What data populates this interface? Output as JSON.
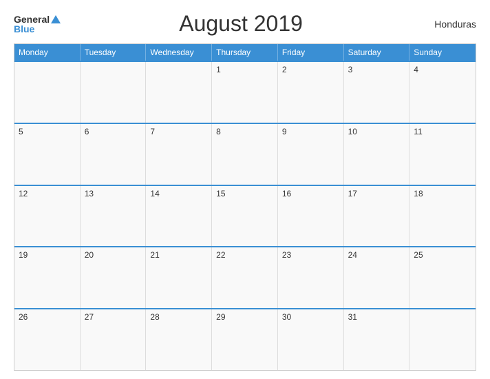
{
  "header": {
    "title": "August 2019",
    "country": "Honduras",
    "logo": {
      "general": "General",
      "blue": "Blue"
    }
  },
  "days": [
    "Monday",
    "Tuesday",
    "Wednesday",
    "Thursday",
    "Friday",
    "Saturday",
    "Sunday"
  ],
  "weeks": [
    [
      {
        "num": "",
        "empty": true
      },
      {
        "num": "",
        "empty": true
      },
      {
        "num": "",
        "empty": true
      },
      {
        "num": "1",
        "empty": false
      },
      {
        "num": "2",
        "empty": false
      },
      {
        "num": "3",
        "empty": false
      },
      {
        "num": "4",
        "empty": false
      }
    ],
    [
      {
        "num": "5",
        "empty": false
      },
      {
        "num": "6",
        "empty": false
      },
      {
        "num": "7",
        "empty": false
      },
      {
        "num": "8",
        "empty": false
      },
      {
        "num": "9",
        "empty": false
      },
      {
        "num": "10",
        "empty": false
      },
      {
        "num": "11",
        "empty": false
      }
    ],
    [
      {
        "num": "12",
        "empty": false
      },
      {
        "num": "13",
        "empty": false
      },
      {
        "num": "14",
        "empty": false
      },
      {
        "num": "15",
        "empty": false
      },
      {
        "num": "16",
        "empty": false
      },
      {
        "num": "17",
        "empty": false
      },
      {
        "num": "18",
        "empty": false
      }
    ],
    [
      {
        "num": "19",
        "empty": false
      },
      {
        "num": "20",
        "empty": false
      },
      {
        "num": "21",
        "empty": false
      },
      {
        "num": "22",
        "empty": false
      },
      {
        "num": "23",
        "empty": false
      },
      {
        "num": "24",
        "empty": false
      },
      {
        "num": "25",
        "empty": false
      }
    ],
    [
      {
        "num": "26",
        "empty": false
      },
      {
        "num": "27",
        "empty": false
      },
      {
        "num": "28",
        "empty": false
      },
      {
        "num": "29",
        "empty": false
      },
      {
        "num": "30",
        "empty": false
      },
      {
        "num": "31",
        "empty": false
      },
      {
        "num": "",
        "empty": true
      }
    ]
  ]
}
